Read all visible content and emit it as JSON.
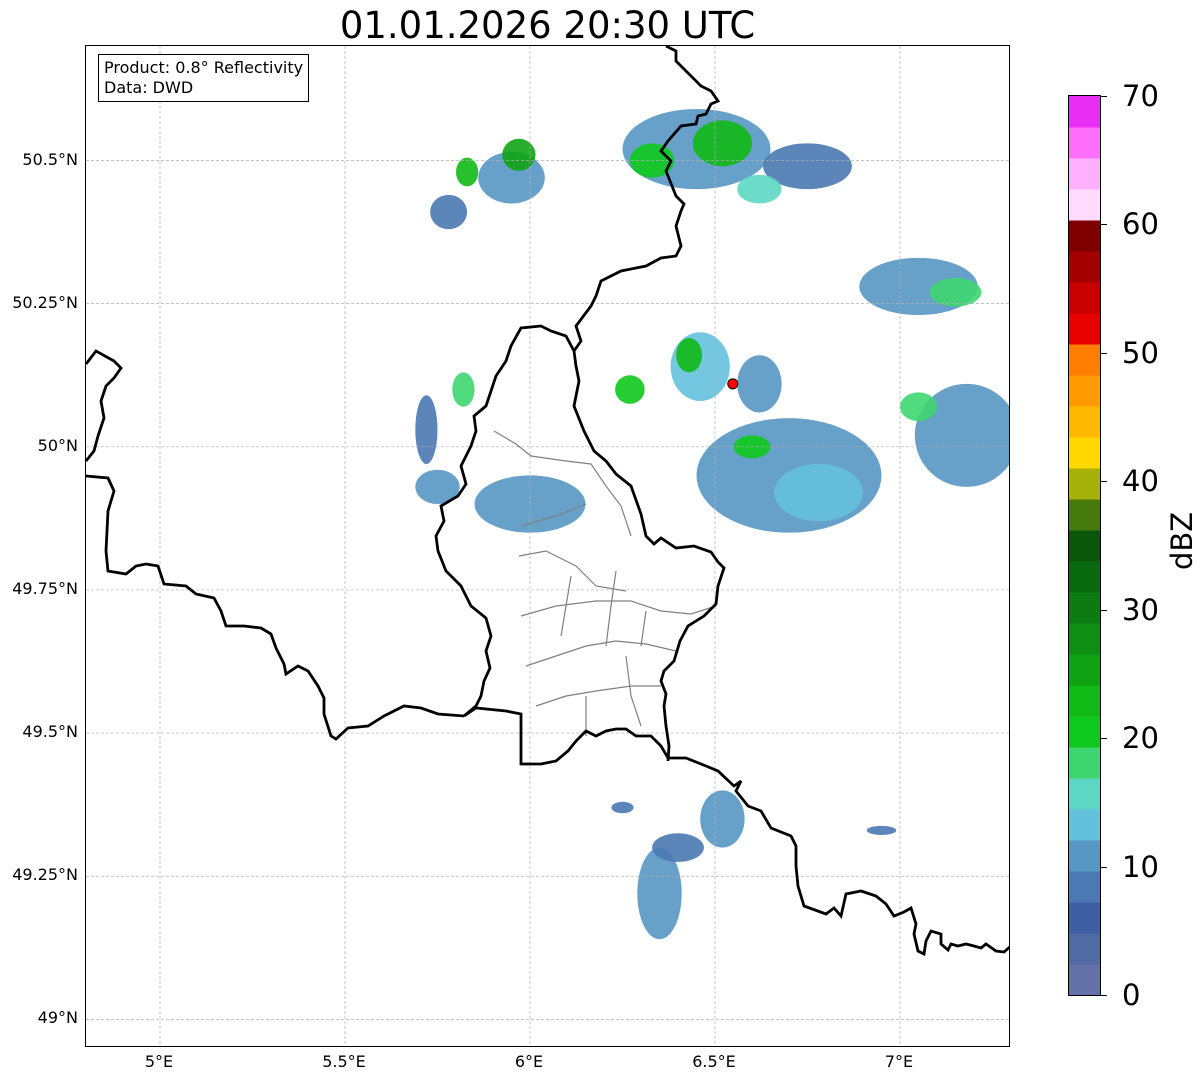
{
  "title": "01.01.2026 20:30 UTC",
  "info_box": {
    "product": "Product: 0.8° Reflectivity",
    "source": "Data: DWD"
  },
  "map": {
    "lon_range": [
      4.8,
      7.3
    ],
    "lat_range": [
      48.95,
      50.7
    ],
    "lat_ticks": [
      {
        "value": 50.5,
        "label": "50.5°N"
      },
      {
        "value": 50.25,
        "label": "50.25°N"
      },
      {
        "value": 50.0,
        "label": "50°N"
      },
      {
        "value": 49.75,
        "label": "49.75°N"
      },
      {
        "value": 49.5,
        "label": "49.5°N"
      },
      {
        "value": 49.25,
        "label": "49.25°N"
      },
      {
        "value": 49.0,
        "label": "49°N"
      }
    ],
    "lon_ticks": [
      {
        "value": 5.0,
        "label": "5°E"
      },
      {
        "value": 5.5,
        "label": "5.5°E"
      },
      {
        "value": 6.0,
        "label": "6°E"
      },
      {
        "value": 6.5,
        "label": "6.5°E"
      },
      {
        "value": 7.0,
        "label": "7°E"
      }
    ],
    "radar_site": {
      "lon": 6.548,
      "lat": 50.11,
      "color": "#ff0000"
    },
    "grid": true
  },
  "colorbar": {
    "label": "dBZ",
    "ticks": [
      "0",
      "10",
      "20",
      "30",
      "40",
      "50",
      "60",
      "70"
    ],
    "tick_values": [
      0,
      10,
      20,
      30,
      40,
      50,
      60,
      70
    ],
    "colors": [
      "#6371a8",
      "#506aa3",
      "#405ea6",
      "#4a79b3",
      "#5697c4",
      "#64c1dd",
      "#5dd7c3",
      "#3ed670",
      "#10c91d",
      "#11b916",
      "#0fa314",
      "#0e8f13",
      "#0b7b12",
      "#0a6a10",
      "#0a570c",
      "#477a0c",
      "#a8b00a",
      "#ffd800",
      "#ffb900",
      "#ff9a00",
      "#ff7d00",
      "#e60000",
      "#c80000",
      "#a50000",
      "#7e0000",
      "#ffdcfe",
      "#ffb0fd",
      "#ff6ffc",
      "#ea2ff4"
    ]
  },
  "precip_cells": [
    {
      "lon": 5.95,
      "lat": 50.47,
      "rx": 0.09,
      "ry": 0.045,
      "dbz": 12
    },
    {
      "lon": 5.97,
      "lat": 50.51,
      "rx": 0.045,
      "ry": 0.028,
      "dbz": 26
    },
    {
      "lon": 5.83,
      "lat": 50.48,
      "rx": 0.03,
      "ry": 0.025,
      "dbz": 22
    },
    {
      "lon": 5.78,
      "lat": 50.41,
      "rx": 0.05,
      "ry": 0.03,
      "dbz": 9
    },
    {
      "lon": 6.45,
      "lat": 50.52,
      "rx": 0.2,
      "ry": 0.07,
      "dbz": 10
    },
    {
      "lon": 6.52,
      "lat": 50.53,
      "rx": 0.08,
      "ry": 0.04,
      "dbz": 24
    },
    {
      "lon": 6.33,
      "lat": 50.5,
      "rx": 0.06,
      "ry": 0.03,
      "dbz": 21
    },
    {
      "lon": 6.75,
      "lat": 50.49,
      "rx": 0.12,
      "ry": 0.04,
      "dbz": 8
    },
    {
      "lon": 6.62,
      "lat": 50.45,
      "rx": 0.06,
      "ry": 0.025,
      "dbz": 16
    },
    {
      "lon": 7.05,
      "lat": 50.28,
      "rx": 0.16,
      "ry": 0.05,
      "dbz": 10
    },
    {
      "lon": 7.15,
      "lat": 50.27,
      "rx": 0.07,
      "ry": 0.025,
      "dbz": 18
    },
    {
      "lon": 6.46,
      "lat": 50.14,
      "rx": 0.08,
      "ry": 0.06,
      "dbz": 14
    },
    {
      "lon": 6.43,
      "lat": 50.16,
      "rx": 0.035,
      "ry": 0.03,
      "dbz": 22
    },
    {
      "lon": 6.62,
      "lat": 50.11,
      "rx": 0.06,
      "ry": 0.05,
      "dbz": 12
    },
    {
      "lon": 6.7,
      "lat": 49.95,
      "rx": 0.25,
      "ry": 0.1,
      "dbz": 10
    },
    {
      "lon": 6.78,
      "lat": 49.92,
      "rx": 0.12,
      "ry": 0.05,
      "dbz": 14
    },
    {
      "lon": 6.6,
      "lat": 50.0,
      "rx": 0.05,
      "ry": 0.02,
      "dbz": 21
    },
    {
      "lon": 7.18,
      "lat": 50.02,
      "rx": 0.14,
      "ry": 0.09,
      "dbz": 11
    },
    {
      "lon": 7.05,
      "lat": 50.07,
      "rx": 0.05,
      "ry": 0.025,
      "dbz": 17
    },
    {
      "lon": 6.27,
      "lat": 50.1,
      "rx": 0.04,
      "ry": 0.025,
      "dbz": 20
    },
    {
      "lon": 5.82,
      "lat": 50.1,
      "rx": 0.03,
      "ry": 0.03,
      "dbz": 18
    },
    {
      "lon": 5.72,
      "lat": 50.03,
      "rx": 0.03,
      "ry": 0.06,
      "dbz": 8
    },
    {
      "lon": 6.0,
      "lat": 49.9,
      "rx": 0.15,
      "ry": 0.05,
      "dbz": 10
    },
    {
      "lon": 5.75,
      "lat": 49.93,
      "rx": 0.06,
      "ry": 0.03,
      "dbz": 11
    },
    {
      "lon": 6.52,
      "lat": 49.35,
      "rx": 0.06,
      "ry": 0.05,
      "dbz": 12
    },
    {
      "lon": 6.35,
      "lat": 49.22,
      "rx": 0.06,
      "ry": 0.08,
      "dbz": 12
    },
    {
      "lon": 6.4,
      "lat": 49.3,
      "rx": 0.07,
      "ry": 0.025,
      "dbz": 9
    },
    {
      "lon": 6.95,
      "lat": 49.33,
      "rx": 0.04,
      "ry": 0.008,
      "dbz": 9
    },
    {
      "lon": 6.25,
      "lat": 49.37,
      "rx": 0.03,
      "ry": 0.01,
      "dbz": 9
    }
  ]
}
